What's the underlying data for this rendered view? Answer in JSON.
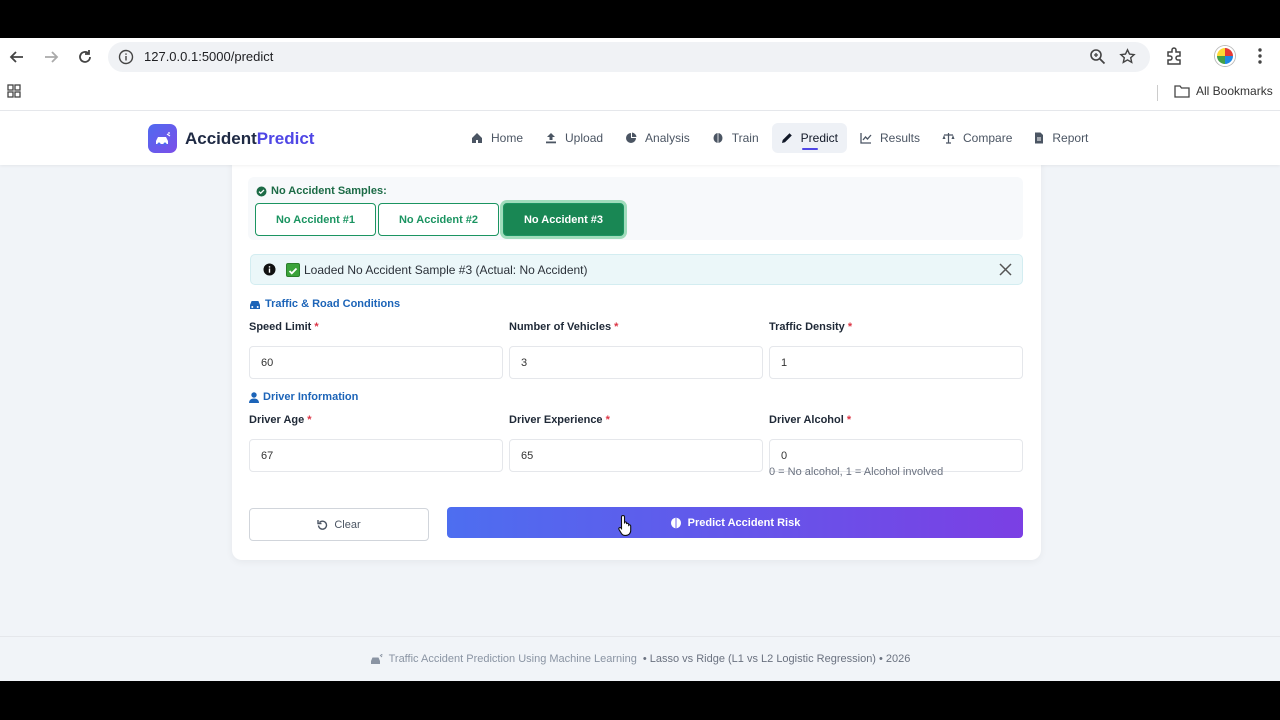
{
  "browser": {
    "url": "127.0.0.1:5000/predict",
    "bookmarks_label": "All Bookmarks"
  },
  "app": {
    "brand_prefix": "Accident",
    "brand_suffix": "Predict",
    "nav": [
      {
        "label": "Home",
        "icon": "home-icon"
      },
      {
        "label": "Upload",
        "icon": "upload-icon"
      },
      {
        "label": "Analysis",
        "icon": "pie-chart-icon"
      },
      {
        "label": "Train",
        "icon": "brain-icon"
      },
      {
        "label": "Predict",
        "icon": "pencil-icon",
        "active": true
      },
      {
        "label": "Results",
        "icon": "line-chart-icon"
      },
      {
        "label": "Compare",
        "icon": "scale-icon"
      },
      {
        "label": "Report",
        "icon": "file-icon"
      }
    ]
  },
  "samples": {
    "title": "No Accident Samples:",
    "buttons": [
      "No Accident #1",
      "No Accident #2",
      "No Accident #3"
    ],
    "active_index": 2
  },
  "alert": {
    "message": "Loaded No Accident Sample #3 (Actual: No Accident)"
  },
  "sections": {
    "traffic": "Traffic & Road Conditions",
    "driver": "Driver Information"
  },
  "fields": {
    "speed_limit": {
      "label": "Speed Limit",
      "value": "60"
    },
    "num_vehicles": {
      "label": "Number of Vehicles",
      "value": "3"
    },
    "traffic_density": {
      "label": "Traffic Density",
      "value": "1"
    },
    "driver_age": {
      "label": "Driver Age",
      "value": "67"
    },
    "driver_experience": {
      "label": "Driver Experience",
      "value": "65"
    },
    "driver_alcohol": {
      "label": "Driver Alcohol",
      "value": "0",
      "hint": "0 = No alcohol, 1 = Alcohol involved"
    }
  },
  "required_mark": "*",
  "actions": {
    "clear": "Clear",
    "predict": "Predict Accident Risk"
  },
  "footer": {
    "highlight": "Traffic Accident Prediction Using Machine Learning",
    "rest": "• Lasso vs Ridge (L1 vs L2 Logistic Regression) • 2026"
  },
  "colors": {
    "accent": "#4f46e5",
    "success": "#198754",
    "section_blue": "#1c64b8"
  }
}
